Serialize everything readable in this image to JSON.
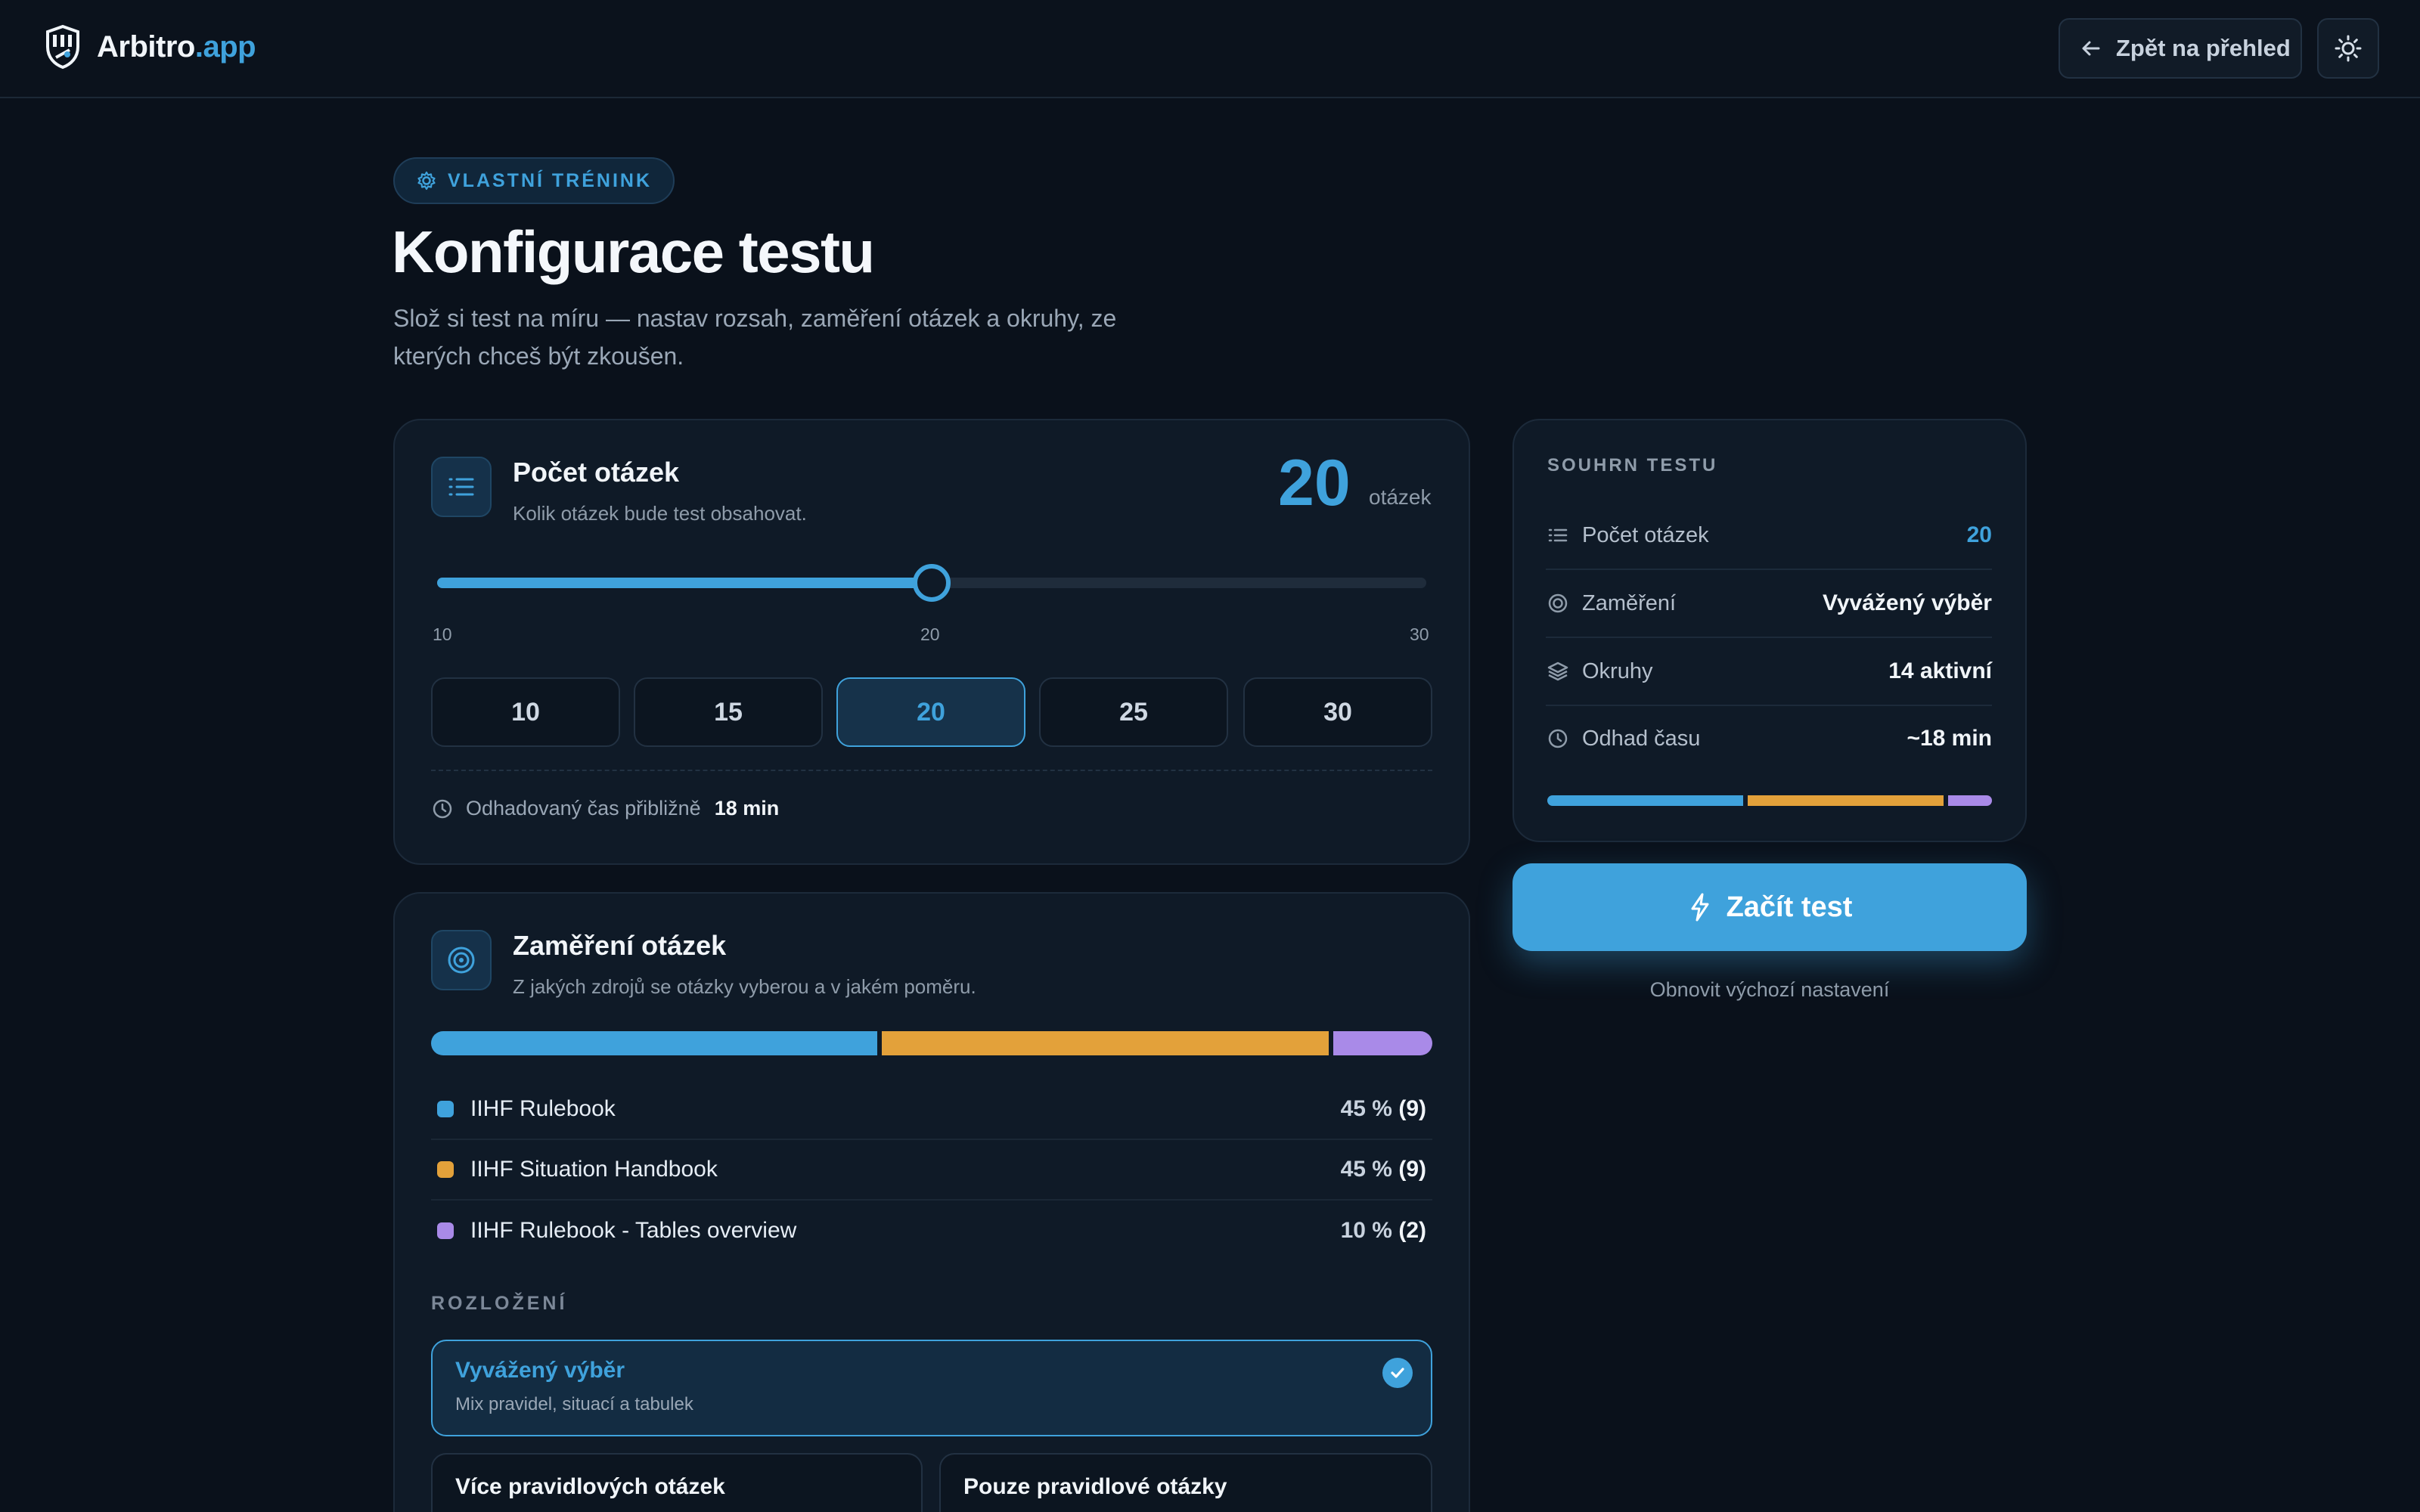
{
  "header": {
    "logo_name": "Arbitro",
    "logo_suffix": ".app",
    "back_label": "Zpět na přehled",
    "back_icon": "arrow-left-icon",
    "theme_icon": "sun-icon"
  },
  "hero": {
    "badge": "VLASTNÍ TRÉNINK",
    "badge_icon": "gear-icon",
    "title": "Konfigurace testu",
    "subtitle": "Slož si test na míru — nastav rozsah, zaměření otázek a okruhy, ze kterých chceš být zkoušen."
  },
  "count_card": {
    "title": "Počet otázek",
    "subtitle": "Kolik otázek bude test obsahovat.",
    "value": "20",
    "unit": "otázek",
    "slider": {
      "min": 10,
      "max": 30,
      "value": 20,
      "min_label": "10",
      "mid_label": "20",
      "max_label": "30"
    },
    "presets": [
      "10",
      "15",
      "20",
      "25",
      "30"
    ],
    "active_preset": "20",
    "estimate_label": "Odhadovaný čas přibližně",
    "estimate_value": "18 min"
  },
  "focus_card": {
    "title": "Zaměření otázek",
    "subtitle": "Z jakých zdrojů se otázky vyberou a v jakém poměru.",
    "sources": [
      {
        "name": "IIHF Rulebook",
        "pct": "45 %",
        "count": "(9)",
        "share": 45,
        "color": "#3fa2dc"
      },
      {
        "name": "IIHF Situation Handbook",
        "pct": "45 %",
        "count": "(9)",
        "share": 45,
        "color": "#e3a13a"
      },
      {
        "name": "IIHF Rulebook - Tables overview",
        "pct": "10 %",
        "count": "(2)",
        "share": 10,
        "color": "#a98ae8"
      }
    ],
    "layout_label": "ROZLOŽENÍ",
    "options": [
      {
        "title": "Vyvážený výběr",
        "desc": "Mix pravidel, situací a tabulek",
        "selected": true
      },
      {
        "title": "Více pravidlových otázek",
        "desc": "",
        "selected": false
      },
      {
        "title": "Pouze pravidlové otázky",
        "desc": "",
        "selected": false
      }
    ]
  },
  "summary": {
    "label": "SOUHRN TESTU",
    "rows": [
      {
        "key": "Počet otázek",
        "value": "20",
        "icon": "list-icon"
      },
      {
        "key": "Zaměření",
        "value": "Vyvážený výběr",
        "icon": "target-icon"
      },
      {
        "key": "Okruhy",
        "value": "14 aktivní",
        "icon": "layers-icon"
      },
      {
        "key": "Odhad času",
        "value": "~18 min",
        "icon": "clock-icon"
      }
    ],
    "start_label": "Začít test",
    "start_icon": "lightning-icon",
    "reset_label": "Obnovit výchozí nastavení"
  },
  "colors": {
    "accent": "#3fa2dc",
    "orange": "#e3a13a",
    "purple": "#a98ae8",
    "background": "#0a111b"
  }
}
